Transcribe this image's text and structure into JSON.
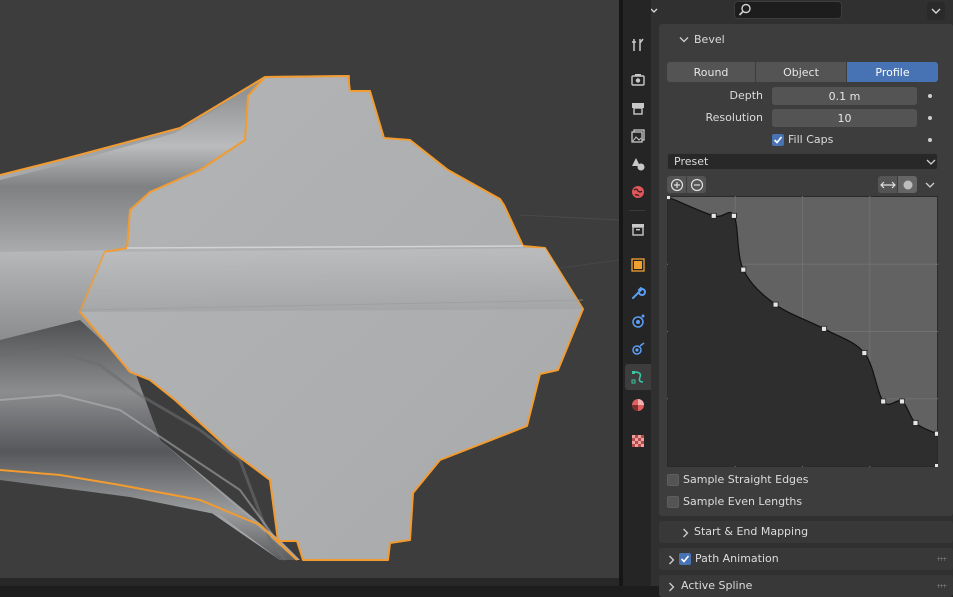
{
  "header": {
    "search": {
      "value": "",
      "placeholder": ""
    }
  },
  "tabs": [
    {
      "name": "tool-icon",
      "color": "#c8c8c8",
      "active": false
    },
    {
      "name": "render-icon",
      "color": "#c8c8c8",
      "active": false
    },
    {
      "name": "output-icon",
      "color": "#c8c8c8",
      "active": false
    },
    {
      "name": "view-layer-icon",
      "color": "#c8c8c8",
      "active": false
    },
    {
      "name": "scene-icon",
      "color": "#c8c8c8",
      "active": false
    },
    {
      "name": "world-icon",
      "color": "#e0575b",
      "active": false
    },
    {
      "name": "collection-icon",
      "color": "#c8c8c8",
      "active": false
    },
    {
      "name": "object-icon",
      "color": "#f0a030",
      "active": false
    },
    {
      "name": "modifier-icon",
      "color": "#5b9ef5",
      "active": false
    },
    {
      "name": "particles-icon",
      "color": "#5b9ef5",
      "active": false
    },
    {
      "name": "physics-icon",
      "color": "#5b9ef5",
      "active": false
    },
    {
      "name": "curve-data-icon",
      "color": "#39c6a4",
      "active": true
    },
    {
      "name": "material-icon",
      "color": "#e05f5f",
      "active": false
    },
    {
      "name": "texture-icon",
      "color": "#e05f5f",
      "active": false
    }
  ],
  "bevel": {
    "title": "Bevel",
    "modes": [
      "Round",
      "Object",
      "Profile"
    ],
    "active_mode": "Profile",
    "depth_label": "Depth",
    "depth_value": "0.1 m",
    "resolution_label": "Resolution",
    "resolution_value": "10",
    "fill_caps_label": "Fill Caps",
    "fill_caps_checked": true,
    "preset_label": "Preset",
    "profile_points": [
      [
        0,
        1
      ],
      [
        0.17,
        0.93
      ],
      [
        0.245,
        0.93
      ],
      [
        0.28,
        0.73
      ],
      [
        0.4,
        0.6
      ],
      [
        0.58,
        0.51
      ],
      [
        0.73,
        0.42
      ],
      [
        0.8,
        0.24
      ],
      [
        0.87,
        0.24
      ],
      [
        0.92,
        0.16
      ],
      [
        1,
        0.12
      ]
    ],
    "sample_straight_edges_label": "Sample Straight Edges",
    "sample_straight_edges_checked": false,
    "sample_even_lengths_label": "Sample Even Lengths",
    "sample_even_lengths_checked": false
  },
  "subpanels": {
    "start_end_mapping": "Start & End Mapping",
    "path_animation": "Path Animation",
    "path_animation_checked": true,
    "active_spline": "Active Spline"
  },
  "colors": {
    "accent": "#4772b3",
    "selection_outline": "#f29b30",
    "panel_bg": "#303030",
    "viewport_bg": "#3d3d3d"
  }
}
